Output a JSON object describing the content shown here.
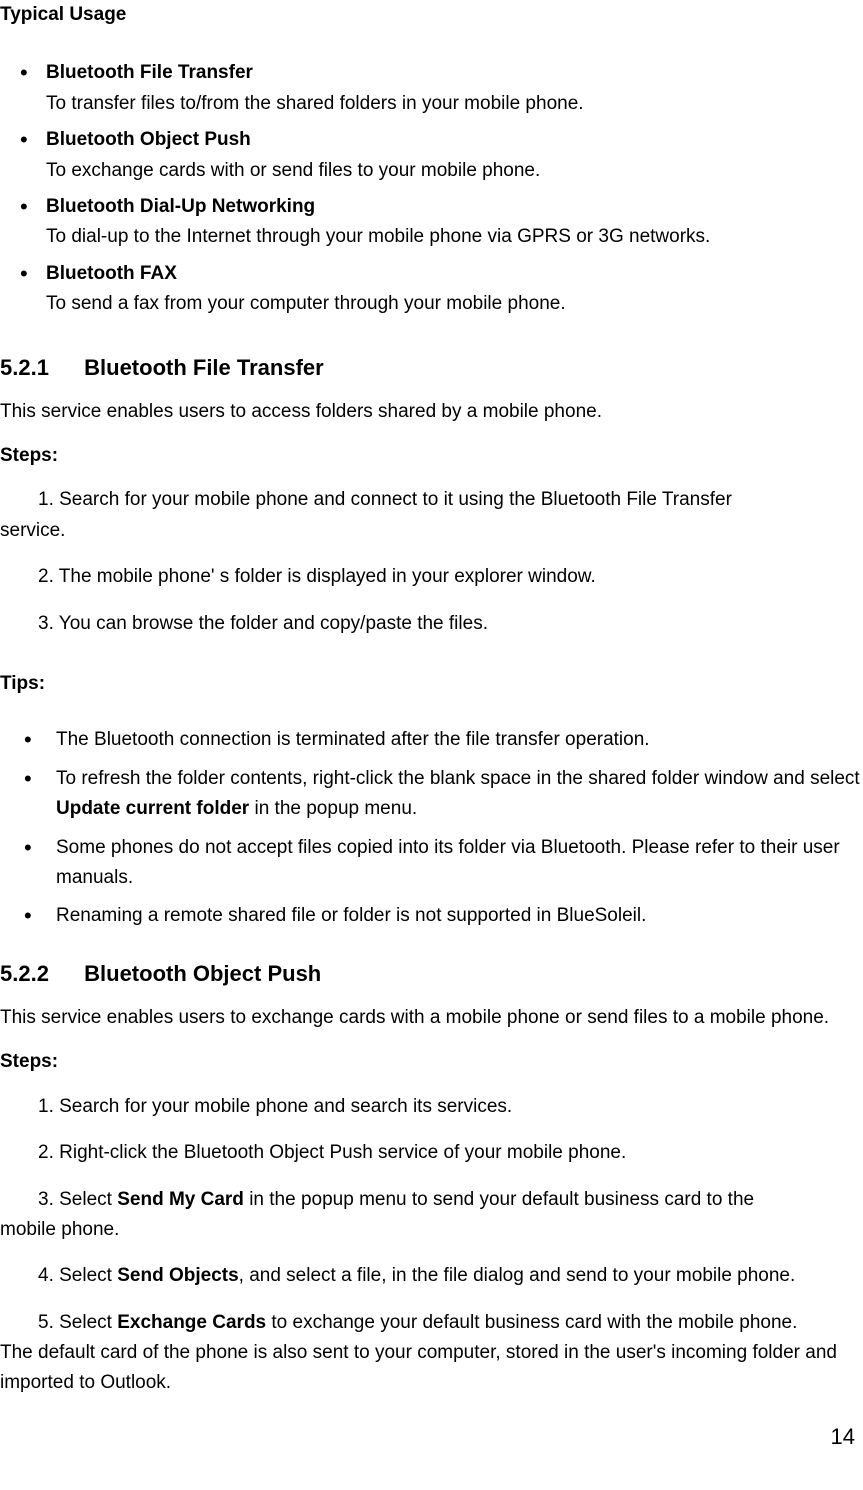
{
  "typicalUsage": {
    "heading": "Typical Usage",
    "items": [
      {
        "title": "Bluetooth File Transfer",
        "desc": "To transfer files to/from the shared folders in your mobile phone."
      },
      {
        "title": "Bluetooth Object Push",
        "desc": "To exchange cards with or send files to your mobile phone."
      },
      {
        "title": "Bluetooth Dial-Up Networking",
        "desc": "To dial-up to the Internet through your mobile phone via GPRS or 3G networks."
      },
      {
        "title": "Bluetooth FAX",
        "desc": "To send a fax from your computer through your mobile phone."
      }
    ]
  },
  "section521": {
    "number": "5.2.1",
    "title": "Bluetooth File Transfer",
    "intro": "This service enables users to access folders shared by a mobile phone.",
    "stepsLabel": "Steps:",
    "steps": {
      "s1a": "1. Search for your mobile phone and connect to it using the Bluetooth File Transfer",
      "s1b": "service.",
      "s2": "2. The mobile phone' s folder is displayed in your explorer window.",
      "s3": "3. You can browse the folder and copy/paste the files."
    },
    "tipsLabel": "Tips:",
    "tips": {
      "t1": "The Bluetooth connection is terminated after the file transfer operation.",
      "t2a": "To refresh the folder contents, right-click the blank space in the shared folder window and select ",
      "t2bold": "Update current folder",
      "t2b": " in the popup menu.",
      "t3": "Some phones do not accept files copied into its folder via Bluetooth. Please refer to their user manuals.",
      "t4": "Renaming a remote shared file or folder is not supported in BlueSoleil."
    }
  },
  "section522": {
    "number": "5.2.2",
    "title": "Bluetooth Object Push",
    "intro": "This service enables users to exchange cards with a mobile phone or send files to a mobile phone.",
    "stepsLabel": "Steps:",
    "steps": {
      "s1": "1. Search for your mobile phone and search its services.",
      "s2": "2. Right-click the Bluetooth Object Push service of your mobile phone.",
      "s3a": "3. Select ",
      "s3bold": "Send My Card",
      "s3b": " in the popup menu to send your default business card to the",
      "s3c": "mobile phone.",
      "s4a": "4. Select ",
      "s4bold": "Send Objects",
      "s4b": ", and select a file, in the file dialog and send to your mobile phone.",
      "s5a": "5. Select ",
      "s5bold": "Exchange Cards",
      "s5b": " to exchange your default business card with the mobile phone.",
      "s5c": "The default card of the phone is also sent to your computer, stored in the user's incoming folder and imported to Outlook."
    }
  },
  "pageNumber": "14"
}
